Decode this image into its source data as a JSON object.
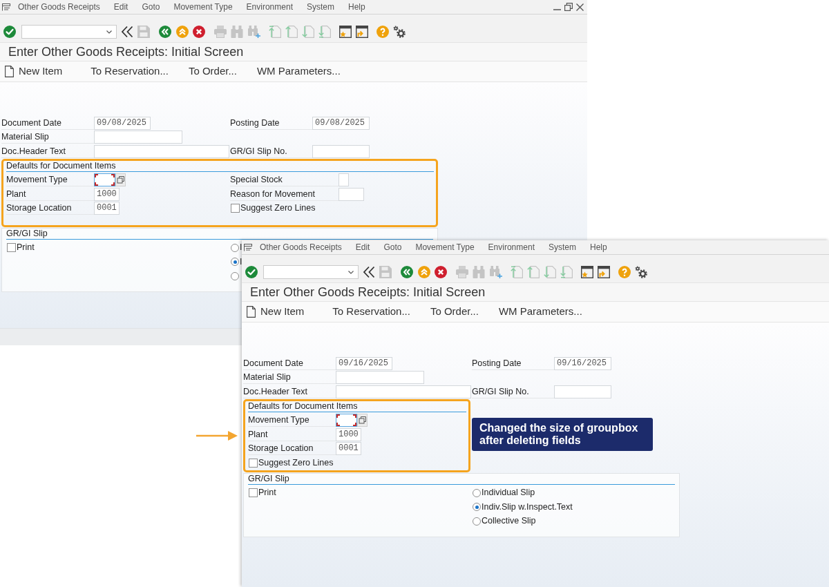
{
  "windows": [
    {
      "window_controls": true,
      "menu": [
        {
          "label": "Other Goods Receipts"
        },
        {
          "label": "Edit"
        },
        {
          "label": "Goto"
        },
        {
          "label": "Movement Type"
        },
        {
          "label": "Environment"
        },
        {
          "label": "System"
        },
        {
          "label": "Help"
        }
      ],
      "title": "Enter Other Goods Receipts: Initial Screen",
      "app_toolbar": [
        {
          "kind": "create",
          "label": "New Item"
        },
        {
          "kind": "plain",
          "label": "To Reservation..."
        },
        {
          "kind": "plain",
          "label": "To Order..."
        },
        {
          "kind": "plain",
          "label": "WM Parameters..."
        }
      ],
      "header_rows": [
        [
          {
            "label": "Document Date",
            "value": "09/08/2025"
          },
          {
            "label": "Posting Date",
            "value": "09/08/2025"
          }
        ],
        [
          {
            "label": "Material Slip"
          }
        ],
        [
          {
            "label": "Doc.Header Text"
          },
          {
            "label": "GR/GI Slip No."
          }
        ]
      ],
      "groups": [
        {
          "title": "Defaults for Document Items",
          "highlighted": true,
          "columns": [
            [
              {
                "kind": "field",
                "label": "Movement Type",
                "focused": true
              },
              {
                "kind": "field",
                "label": "Plant",
                "value": "1000",
                "focused": false
              },
              {
                "kind": "field",
                "label": "Storage Location",
                "value": "0001",
                "focused": false
              }
            ],
            [
              {
                "kind": "field",
                "label": "Special Stock",
                "focused": false
              },
              {
                "kind": "field",
                "label": "Reason for Movement",
                "focused": false
              },
              {
                "kind": "checkbox",
                "label": "Suggest Zero Lines",
                "checked": false
              }
            ]
          ]
        },
        {
          "title": "GR/GI Slip",
          "highlighted": false,
          "columns": [
            [
              {
                "kind": "checkbox",
                "label": "Print",
                "checked": false
              }
            ],
            [
              {
                "kind": "radio",
                "label": "I",
                "selected": false
              },
              {
                "kind": "radio",
                "label": "I",
                "selected": true
              },
              {
                "kind": "radio",
                "selected": false
              }
            ]
          ]
        }
      ]
    },
    {
      "window_controls": false,
      "menu": [
        {
          "label": "Other Goods Receipts"
        },
        {
          "label": "Edit"
        },
        {
          "label": "Goto"
        },
        {
          "label": "Movement Type"
        },
        {
          "label": "Environment"
        },
        {
          "label": "System"
        },
        {
          "label": "Help"
        }
      ],
      "title": "Enter Other Goods Receipts: Initial Screen",
      "app_toolbar": [
        {
          "kind": "create",
          "label": "New Item"
        },
        {
          "kind": "plain",
          "label": "To Reservation..."
        },
        {
          "kind": "plain",
          "label": "To Order..."
        },
        {
          "kind": "plain",
          "label": "WM Parameters..."
        }
      ],
      "header_rows": [
        [
          {
            "label": "Document Date",
            "value": "09/16/2025"
          },
          {
            "label": "Posting Date",
            "value": "09/16/2025"
          }
        ],
        [
          {
            "label": "Material Slip"
          }
        ],
        [
          {
            "label": "Doc.Header Text"
          },
          {
            "label": "GR/GI Slip No."
          }
        ]
      ],
      "groups": [
        {
          "title": "Defaults for Document Items",
          "highlighted": true,
          "columns": [
            [
              {
                "kind": "field",
                "label": "Movement Type",
                "focused": true
              },
              {
                "kind": "field",
                "label": "Plant",
                "value": "1000",
                "focused": false
              },
              {
                "kind": "field",
                "label": "Storage Location",
                "value": "0001",
                "focused": false
              },
              {
                "kind": "checkbox",
                "label": "Suggest Zero Lines",
                "checked": false
              }
            ]
          ]
        },
        {
          "title": "GR/GI Slip",
          "highlighted": false,
          "columns": [
            [
              {
                "kind": "checkbox",
                "label": "Print",
                "checked": false
              }
            ],
            [
              {
                "kind": "radio",
                "label": "Individual Slip",
                "selected": false
              },
              {
                "kind": "radio",
                "label": "Indiv.Slip w.Inspect.Text",
                "selected": true
              },
              {
                "kind": "radio",
                "label": "Collective Slip",
                "selected": false
              }
            ]
          ]
        }
      ]
    }
  ],
  "annotation": {
    "text": "Changed the size of groupbox after deleting fields"
  }
}
